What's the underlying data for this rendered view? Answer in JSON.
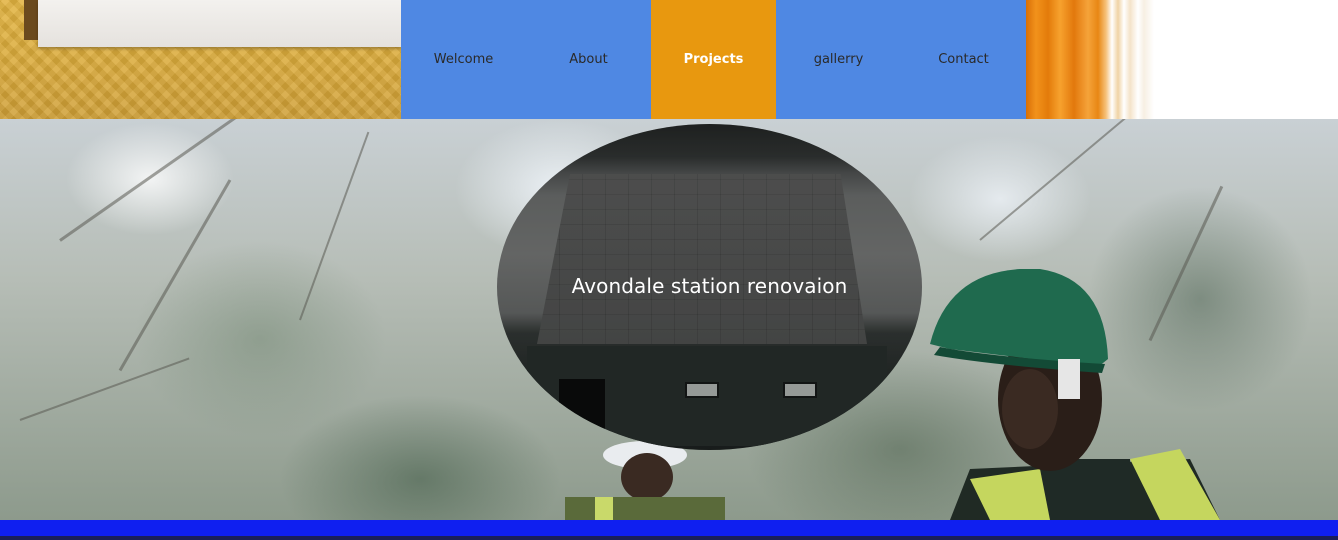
{
  "nav": {
    "items": [
      {
        "label": "Welcome"
      },
      {
        "label": "About"
      },
      {
        "label": "Projects"
      },
      {
        "label": "gallerry"
      },
      {
        "label": "Contact"
      }
    ],
    "active_index": 2
  },
  "hero": {
    "project_title": "Avondale station renovaion"
  },
  "colors": {
    "nav_background": "#4f88e3",
    "nav_active": "#e8980f",
    "footer_bar": "#0f1ff0"
  }
}
